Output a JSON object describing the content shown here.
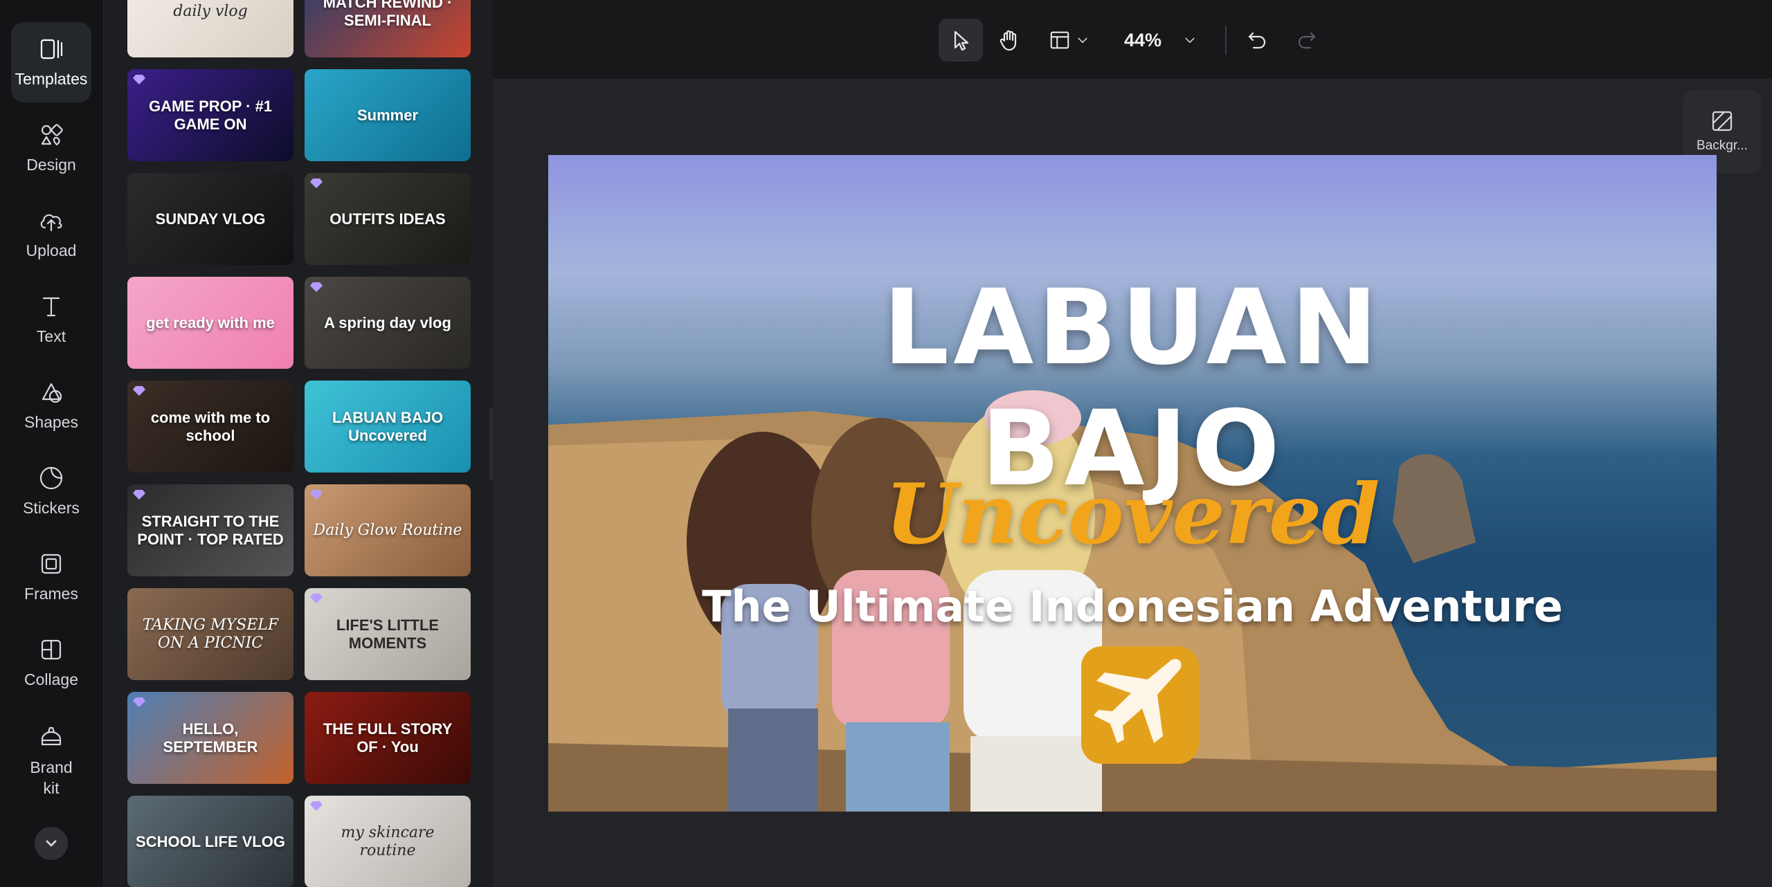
{
  "rail": {
    "items": [
      {
        "label": "Templates",
        "icon": "templates-icon",
        "active": true
      },
      {
        "label": "Design",
        "icon": "design-icon"
      },
      {
        "label": "Upload",
        "icon": "upload-icon"
      },
      {
        "label": "Text",
        "icon": "text-icon"
      },
      {
        "label": "Shapes",
        "icon": "shapes-icon"
      },
      {
        "label": "Stickers",
        "icon": "stickers-icon"
      },
      {
        "label": "Frames",
        "icon": "frames-icon"
      },
      {
        "label": "Collage",
        "icon": "collage-icon"
      },
      {
        "label": "Brand\nkit",
        "icon": "brand-kit-icon"
      }
    ]
  },
  "templates": [
    {
      "text": "daily vlog",
      "style": "light-serif",
      "colors": [
        "#f3eee8",
        "#d8cfc4"
      ],
      "premium": false
    },
    {
      "text": "MATCH REWIND · SEMI-FINAL",
      "style": "sport",
      "colors": [
        "#2a3e6c",
        "#c8452d"
      ],
      "premium": false
    },
    {
      "text": "GAME PROP · #1 GAME ON",
      "style": "game",
      "colors": [
        "#3b1f8a",
        "#0d0d2a"
      ],
      "premium": true
    },
    {
      "text": "Summer",
      "style": "summer",
      "colors": [
        "#2aa6c9",
        "#0e6e8f"
      ],
      "premium": false
    },
    {
      "text": "SUNDAY VLOG",
      "style": "dark",
      "colors": [
        "#2b2b2b",
        "#111111"
      ],
      "premium": false
    },
    {
      "text": "OUTFITS IDEAS",
      "style": "dark",
      "colors": [
        "#3a3a35",
        "#1a1a18"
      ],
      "premium": true
    },
    {
      "text": "get ready with me",
      "style": "pink",
      "colors": [
        "#f4a6c8",
        "#ef7fb0"
      ],
      "premium": false
    },
    {
      "text": "A spring day vlog",
      "style": "dark",
      "colors": [
        "#4a4744",
        "#2a2826"
      ],
      "premium": true
    },
    {
      "text": "come with me to school",
      "style": "dark",
      "colors": [
        "#3b2e26",
        "#1c1612"
      ],
      "premium": true
    },
    {
      "text": "LABUAN BAJO Uncovered",
      "style": "sea",
      "colors": [
        "#3fc3d6",
        "#1a8fb0"
      ],
      "premium": false
    },
    {
      "text": "STRAIGHT TO THE POINT · TOP RATED",
      "style": "dark",
      "colors": [
        "#2b2b2d",
        "#555555"
      ],
      "premium": true
    },
    {
      "text": "Daily Glow Routine",
      "style": "warm",
      "colors": [
        "#c89a72",
        "#8a5d3d"
      ],
      "premium": true
    },
    {
      "text": "TAKING MYSELF ON A PICNIC",
      "style": "warm",
      "colors": [
        "#8a6a52",
        "#4e3a2c"
      ],
      "premium": false
    },
    {
      "text": "LIFE'S LITTLE MOMENTS",
      "style": "light",
      "colors": [
        "#d9d6d0",
        "#a8a39b"
      ],
      "premium": true
    },
    {
      "text": "HELLO, SEPTEMBER",
      "style": "autumn",
      "colors": [
        "#4f7fb6",
        "#c2612b"
      ],
      "premium": true
    },
    {
      "text": "THE FULL STORY OF · You",
      "style": "red",
      "colors": [
        "#8b1c13",
        "#3b0a06"
      ],
      "premium": false
    },
    {
      "text": "SCHOOL LIFE VLOG",
      "style": "dark",
      "colors": [
        "#5c6b74",
        "#2c3338"
      ],
      "premium": false
    },
    {
      "text": "my skincare routine",
      "style": "light-serif",
      "colors": [
        "#e6e3df",
        "#b7b2ac"
      ],
      "premium": true
    }
  ],
  "toolbar": {
    "zoom": "44%",
    "tools": [
      "select-pointer-icon",
      "hand-pan-icon",
      "layout-icon",
      "undo-icon",
      "redo-icon"
    ]
  },
  "background_button": {
    "label": "Backgr..."
  },
  "canvas": {
    "title_line1": "LABUAN",
    "title_line2": "BAJO",
    "script": "Uncovered",
    "subtitle": "The Ultimate Indonesian Adventure",
    "accent": "#f2a51a"
  }
}
